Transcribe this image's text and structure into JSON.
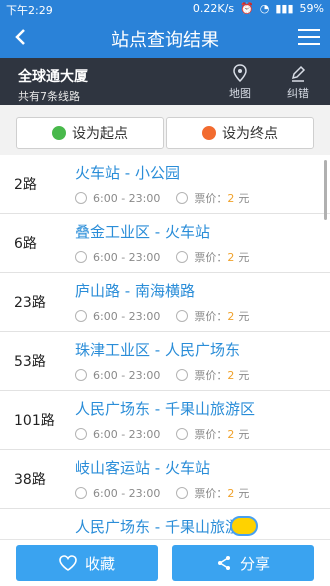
{
  "status_bar": {
    "time": "下午2:29",
    "network_speed": "0.22K/s",
    "battery": "59%"
  },
  "nav": {
    "title": "站点查询结果"
  },
  "stop": {
    "name": "全球通大厦",
    "line_count_text": "共有7条线路",
    "map_label": "地图",
    "correct_label": "纠错"
  },
  "actions": {
    "set_start_label": "设为起点",
    "set_end_label": "设为终点",
    "favorite_label": "收藏",
    "share_label": "分享"
  },
  "routes": [
    {
      "number": "2路",
      "name": "火车站 - 小公园",
      "hours": "6:00 - 23:00",
      "price_label": "票价：",
      "price": "2",
      "unit": "元"
    },
    {
      "number": "6路",
      "name": "叠金工业区 - 火车站",
      "hours": "6:00 - 23:00",
      "price_label": "票价：",
      "price": "2",
      "unit": "元"
    },
    {
      "number": "23路",
      "name": "庐山路 - 南海横路",
      "hours": "6:00 - 23:00",
      "price_label": "票价：",
      "price": "2",
      "unit": "元"
    },
    {
      "number": "53路",
      "name": "珠津工业区 - 人民广场东",
      "hours": "6:00 - 23:00",
      "price_label": "票价：",
      "price": "2",
      "unit": "元"
    },
    {
      "number": "101路",
      "name": "人民广场东 - 千果山旅游区",
      "hours": "6:00 - 23:00",
      "price_label": "票价：",
      "price": "2",
      "unit": "元"
    },
    {
      "number": "38路",
      "name": "岐山客运站 - 火车站",
      "hours": "6:00 - 23:00",
      "price_label": "票价：",
      "price": "2",
      "unit": "元"
    },
    {
      "number": "",
      "name": "人民广场东 - 千果山旅游区",
      "hours": "",
      "price_label": "",
      "price": "",
      "unit": ""
    }
  ],
  "colors": {
    "primary": "#2a82d8",
    "dark_bar": "#2f3540",
    "route_text": "#2a8dd8",
    "price": "#f0a12a",
    "start_dot": "#48b94b",
    "end_dot": "#f26b2f",
    "bottom_button": "#3aa3f0"
  },
  "icons": {
    "back": "back-arrow-icon",
    "menu": "hamburger-menu-icon",
    "map": "map-pin-icon",
    "edit": "pencil-icon",
    "clock": "clock-icon",
    "coin": "coin-icon",
    "heart": "heart-icon",
    "share": "share-icon"
  }
}
